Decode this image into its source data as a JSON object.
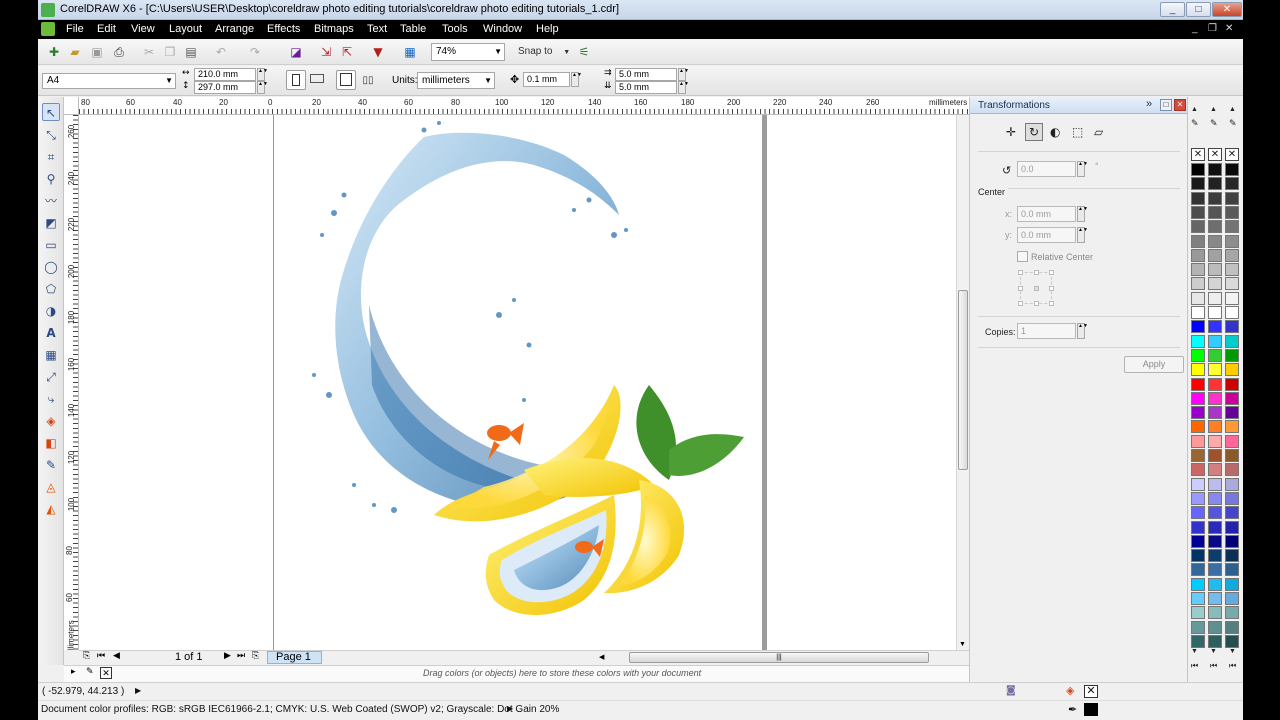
{
  "window": {
    "title": "CorelDRAW X6 - [C:\\Users\\USER\\Desktop\\coreldraw photo editing tutorials\\coreldraw photo editing tutorials_1.cdr]",
    "minimize": "_",
    "maximize": "□",
    "close": "✕"
  },
  "menu": {
    "items": [
      "File",
      "Edit",
      "View",
      "Layout",
      "Arrange",
      "Effects",
      "Bitmaps",
      "Text",
      "Table",
      "Tools",
      "Window",
      "Help"
    ],
    "right_controls": [
      "_",
      "❐",
      "✕"
    ]
  },
  "standard_toolbar": {
    "zoom_level": "74%",
    "snap_to": "Snap to"
  },
  "property_bar": {
    "page_size": "A4",
    "width": "210.0 mm",
    "height": "297.0 mm",
    "units_label": "Units:",
    "units_value": "millimeters",
    "nudge": "0.1 mm",
    "duplicate_x": "5.0 mm",
    "duplicate_y": "5.0 mm"
  },
  "rulers": {
    "horizontal_ticks": [
      "80",
      "60",
      "40",
      "20",
      "0",
      "20",
      "40",
      "60",
      "80",
      "100",
      "120",
      "140",
      "160",
      "180",
      "200",
      "220",
      "240",
      "260"
    ],
    "horizontal_unit": "millimeters",
    "vertical_ticks": [
      "260",
      "240",
      "220",
      "200",
      "180",
      "160",
      "140",
      "120",
      "100",
      "80",
      "60"
    ],
    "vertical_unit": "millimeters"
  },
  "page_navigator": {
    "page_count": "1 of 1",
    "page_tab": "Page 1"
  },
  "document_palette": {
    "hint": "Drag colors (or objects) here to store these colors with your document"
  },
  "docker": {
    "title": "Transformations",
    "rotation_value": "0.0",
    "degree_symbol": "°",
    "center_label": "Center",
    "x_label": "x:",
    "x_value": "0.0 mm",
    "y_label": "y:",
    "y_value": "0.0 mm",
    "relative_center": "Relative Center",
    "copies_label": "Copies:",
    "copies_value": "1",
    "apply": "Apply"
  },
  "palette": {
    "columns": [
      [
        "#000000",
        "#1a1a1a",
        "#333333",
        "#4d4d4d",
        "#666666",
        "#808080",
        "#999999",
        "#b3b3b3",
        "#cccccc",
        "#e6e6e6",
        "#ffffff",
        "#0000ff",
        "#00ffff",
        "#00ff00",
        "#ffff00",
        "#ff0000",
        "#ff00ff",
        "#9900cc",
        "#ff6600",
        "#ff9999",
        "#996633",
        "#cc6666",
        "#ccccff",
        "#9999ff",
        "#6666ff",
        "#3333cc",
        "#000099",
        "#003366",
        "#336699",
        "#00ccff",
        "#66ccff",
        "#99cccc",
        "#669999",
        "#336666"
      ],
      [
        "#111111",
        "#222222",
        "#3b3b3b",
        "#555555",
        "#6e6e6e",
        "#888888",
        "#a1a1a1",
        "#bbbbbb",
        "#d4d4d4",
        "#eeeeee",
        "#ffffff",
        "#3333ff",
        "#33ccff",
        "#33cc33",
        "#ffff33",
        "#ff3333",
        "#ff33cc",
        "#aa33cc",
        "#ff7f27",
        "#ffaaaa",
        "#a0522d",
        "#d47f7f",
        "#bbbbee",
        "#8888ee",
        "#5555dd",
        "#2b2bbb",
        "#0a0a88",
        "#0d3d6b",
        "#3a6ea5",
        "#22bbee",
        "#77bbee",
        "#88bbbb",
        "#5f8f8f",
        "#2e5e5e"
      ],
      [
        "#090909",
        "#272727",
        "#404040",
        "#5a5a5a",
        "#737373",
        "#8d8d8d",
        "#a6a6a6",
        "#c0c0c0",
        "#d9d9d9",
        "#f3f3f3",
        "#ffffff",
        "#3333cc",
        "#00cccc",
        "#009900",
        "#ffcc00",
        "#cc0000",
        "#cc0099",
        "#660099",
        "#ff9933",
        "#ff6699",
        "#8b5a2b",
        "#b86b6b",
        "#aaaadd",
        "#7777dd",
        "#4444cc",
        "#2222aa",
        "#000077",
        "#0b2f55",
        "#2f5f8f",
        "#11aadd",
        "#66aadd",
        "#77aaaa",
        "#557f7f",
        "#254f4f"
      ]
    ]
  },
  "status": {
    "coords": "( -52.979, 44.213 )",
    "color_profiles": "Document color profiles: RGB: sRGB IEC61966-2.1; CMYK: U.S. Web Coated (SWOP) v2; Grayscale: Dot Gain 20%"
  }
}
